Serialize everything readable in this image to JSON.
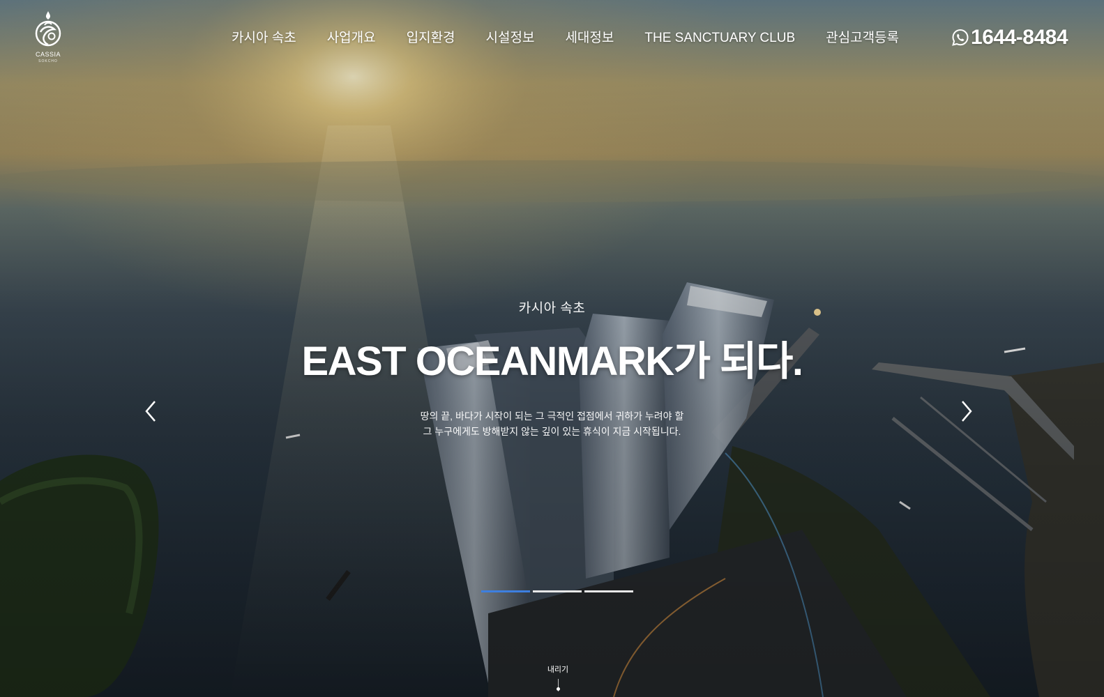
{
  "brand": {
    "name": "CASSIA",
    "sub": "SOKCHO",
    "logo_icon": "cassia-emblem-icon"
  },
  "nav": {
    "items": [
      {
        "label": "카시아 속초"
      },
      {
        "label": "사업개요"
      },
      {
        "label": "입지환경"
      },
      {
        "label": "시설정보"
      },
      {
        "label": "세대정보"
      },
      {
        "label": "THE SANCTUARY CLUB"
      },
      {
        "label": "관심고객등록"
      }
    ]
  },
  "contact": {
    "icon": "whatsapp-phone-icon",
    "phone": "1644-8484"
  },
  "hero": {
    "eyebrow": "카시아 속초",
    "headline": "EAST OCEANMARK가 되다.",
    "desc_line1": "땅의 끝, 바다가 시작이 되는 그 극적인 접점에서 귀하가 누려야 할",
    "desc_line2": "그 누구에게도 방해받지 않는 깊이 있는 휴식이 지금 시작됩니다.",
    "prev_icon": "chevron-left-icon",
    "next_icon": "chevron-right-icon"
  },
  "slider": {
    "count": 3,
    "active_index": 0,
    "active_color": "#3d7fe0"
  },
  "scroll": {
    "label": "내리기",
    "icon": "scroll-down-icon"
  }
}
